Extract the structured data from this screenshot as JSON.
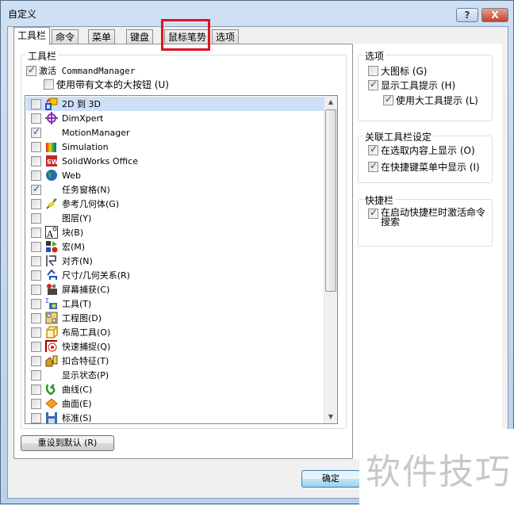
{
  "window": {
    "title": "自定义",
    "help_label": "?",
    "close_label": "X"
  },
  "tabs": [
    {
      "label": "工具栏",
      "active": true
    },
    {
      "label": "命令"
    },
    {
      "label": "菜单"
    },
    {
      "label": "键盘"
    },
    {
      "label": "鼠标笔势",
      "highlighted": true
    },
    {
      "label": "选项"
    }
  ],
  "toolbar_group": {
    "label": "工具栏",
    "activate_cm": {
      "label": "激活 CommandManager",
      "checked": true
    },
    "large_buttons": {
      "label": "使用带有文本的大按钮 (U)",
      "checked": false
    }
  },
  "toolbar_list": [
    {
      "label": "2D 到 3D",
      "checked": false,
      "icon": "2d-to-3d-icon",
      "selected": true
    },
    {
      "label": "DimXpert",
      "checked": false,
      "icon": "dimxpert-icon"
    },
    {
      "label": "MotionManager",
      "checked": true,
      "icon": ""
    },
    {
      "label": "Simulation",
      "checked": false,
      "icon": "simulation-icon"
    },
    {
      "label": "SolidWorks Office",
      "checked": false,
      "icon": "solidworks-office-icon"
    },
    {
      "label": "Web",
      "checked": false,
      "icon": "web-globe-icon"
    },
    {
      "label": "任务窗格(N)",
      "checked": true,
      "icon": ""
    },
    {
      "label": "参考几何体(G)",
      "checked": false,
      "icon": "reference-geometry-icon"
    },
    {
      "label": "图层(Y)",
      "checked": false,
      "icon": ""
    },
    {
      "label": "块(B)",
      "checked": false,
      "icon": "block-icon"
    },
    {
      "label": "宏(M)",
      "checked": false,
      "icon": "macro-icon"
    },
    {
      "label": "对齐(N)",
      "checked": false,
      "icon": "align-icon"
    },
    {
      "label": "尺寸/几何关系(R)",
      "checked": false,
      "icon": "dimension-relation-icon"
    },
    {
      "label": "屏幕捕获(C)",
      "checked": false,
      "icon": "screen-capture-icon"
    },
    {
      "label": "工具(T)",
      "checked": false,
      "icon": "tools-icon"
    },
    {
      "label": "工程图(D)",
      "checked": false,
      "icon": "drawing-icon"
    },
    {
      "label": "布局工具(O)",
      "checked": false,
      "icon": "layout-tools-icon"
    },
    {
      "label": "快速捕捉(Q)",
      "checked": false,
      "icon": "quick-snap-icon"
    },
    {
      "label": "扣合特征(T)",
      "checked": false,
      "icon": "fastening-feature-icon"
    },
    {
      "label": "显示状态(P)",
      "checked": false,
      "icon": ""
    },
    {
      "label": "曲线(C)",
      "checked": false,
      "icon": "curves-icon"
    },
    {
      "label": "曲面(E)",
      "checked": false,
      "icon": "surfaces-icon"
    },
    {
      "label": "标准(S)",
      "checked": false,
      "icon": "standard-save-icon"
    }
  ],
  "options_group": {
    "label": "选项",
    "items": [
      {
        "label": "大图标 (G)",
        "checked": false
      },
      {
        "label": "显示工具提示 (H)",
        "checked": true
      },
      {
        "label": "使用大工具提示 (L)",
        "checked": true
      }
    ]
  },
  "context_group": {
    "label": "关联工具栏设定",
    "items": [
      {
        "label": "在选取内容上显示 (O)",
        "checked": true
      },
      {
        "label": "在快捷键菜单中显示 (I)",
        "checked": true
      }
    ]
  },
  "shortcut_group": {
    "label": "快捷栏",
    "items": [
      {
        "label": "在启动快捷栏时激活命令搜索",
        "checked": true
      }
    ]
  },
  "buttons": {
    "reset": "重设到默认 (R)",
    "ok": "确定"
  },
  "watermark": "软件技巧",
  "colors": {
    "highlight_box": "#e0141e",
    "selection": "#cde0f7"
  }
}
